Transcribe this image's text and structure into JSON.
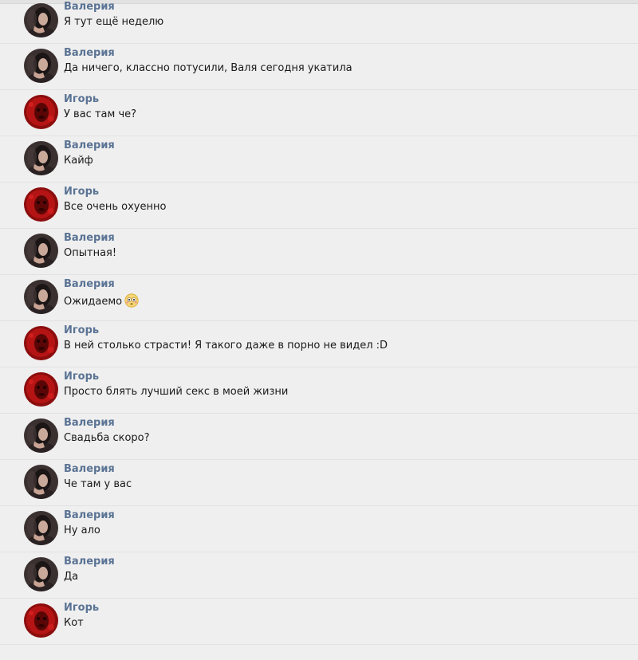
{
  "messages": [
    {
      "author": "Валерия",
      "text": "Я тут ещё неделю",
      "avatar": "valeria-avatar"
    },
    {
      "author": "Валерия",
      "text": "Да ничего, классно потусили, Валя сегодня укатила",
      "avatar": "valeria-avatar"
    },
    {
      "author": "Игорь",
      "text": "У вас там че?",
      "avatar": "igor-avatar"
    },
    {
      "author": "Валерия",
      "text": "Кайф",
      "avatar": "valeria-avatar"
    },
    {
      "author": "Игорь",
      "text": "Все очень охуенно",
      "avatar": "igor-avatar"
    },
    {
      "author": "Валерия",
      "text": "Опытная!",
      "avatar": "valeria-avatar"
    },
    {
      "author": "Валерия",
      "text": "Ожидаемо",
      "avatar": "valeria-avatar",
      "emoji": "flushed-face-icon"
    },
    {
      "author": "Игорь",
      "text": "В ней столько страсти! Я такого даже в порно не видел :D",
      "avatar": "igor-avatar"
    },
    {
      "author": "Игорь",
      "text": "Просто блять лучший секс в моей жизни",
      "avatar": "igor-avatar"
    },
    {
      "author": "Валерия",
      "text": "Свадьба скоро?",
      "avatar": "valeria-avatar"
    },
    {
      "author": "Валерия",
      "text": "Че там у вас",
      "avatar": "valeria-avatar"
    },
    {
      "author": "Валерия",
      "text": "Ну ало",
      "avatar": "valeria-avatar"
    },
    {
      "author": "Валерия",
      "text": "Да",
      "avatar": "valeria-avatar"
    },
    {
      "author": "Игорь",
      "text": "Кот",
      "avatar": "igor-avatar"
    }
  ],
  "colors": {
    "background": "#efefef",
    "author_name": "#5a7394",
    "message_text": "#1a1a1a",
    "divider": "#e2e2e2"
  }
}
